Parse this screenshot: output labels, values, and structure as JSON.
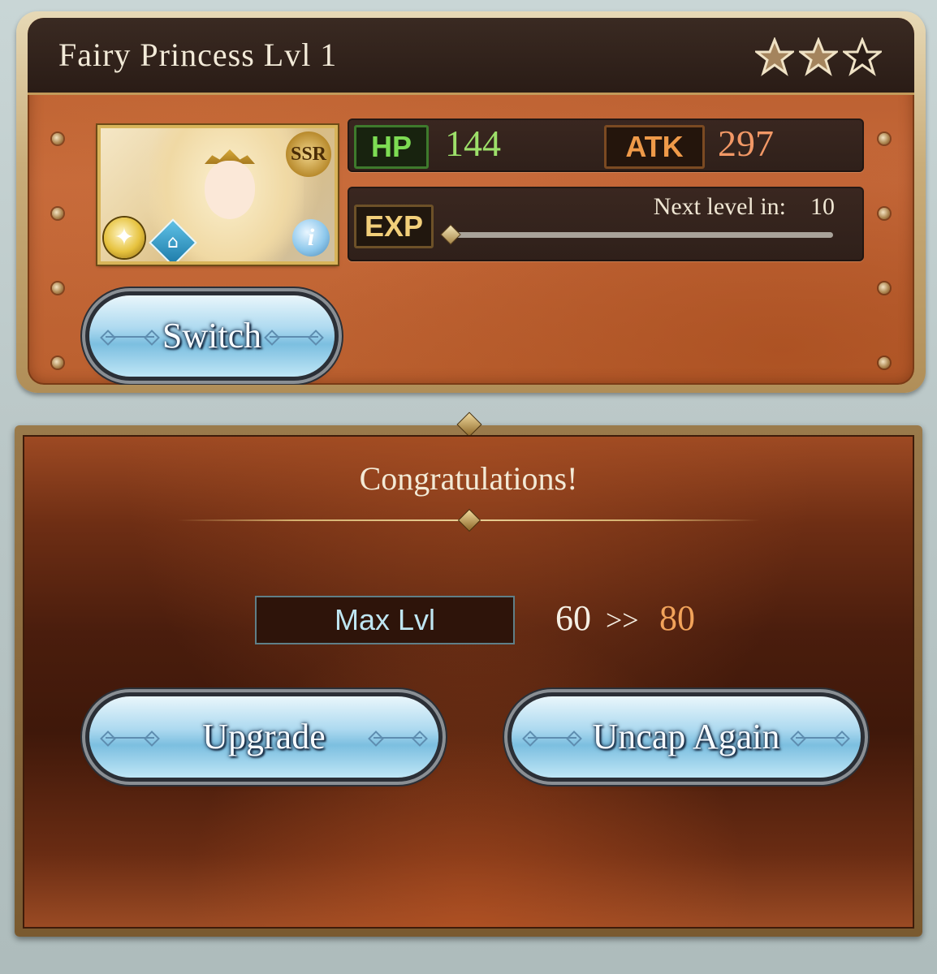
{
  "character": {
    "title": "Fairy Princess  Lvl  1",
    "rarity_badge": "SSR",
    "stars_filled": 2,
    "stars_total": 3
  },
  "stats": {
    "hp_label": "HP",
    "hp_value": "144",
    "atk_label": "ATK",
    "atk_value": "297",
    "exp_label": "EXP",
    "next_level_label": "Next level in:",
    "next_level_value": "10",
    "exp_progress": 0.0
  },
  "buttons": {
    "switch": "Switch",
    "upgrade": "Upgrade",
    "uncap_again": "Uncap Again"
  },
  "result": {
    "heading": "Congratulations!",
    "max_lvl_label": "Max Lvl",
    "from": "60",
    "arrow": ">>",
    "to": "80"
  },
  "colors": {
    "hp": "#9de06a",
    "atk": "#f29866",
    "uncap_to": "#f2a35a",
    "max_lvl_text": "#bfe6f2"
  },
  "icons": {
    "element": "light-element-icon",
    "home": "home-icon",
    "info": "info-icon"
  }
}
